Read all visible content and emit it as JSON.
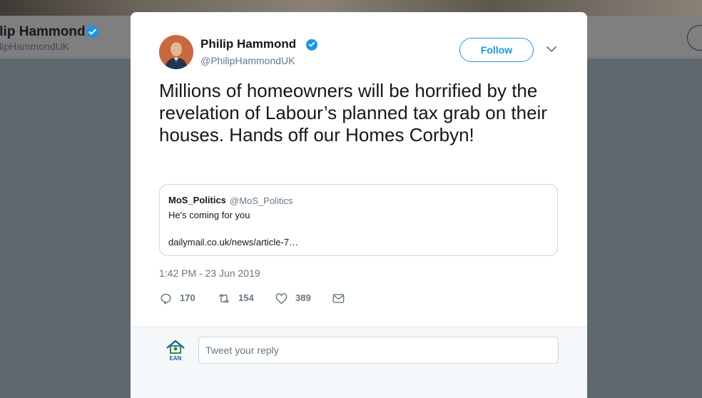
{
  "background": {
    "profile_name": "ilip Hammond",
    "profile_handle": "ilipHammondUK"
  },
  "tweet": {
    "author_name": "Philip Hammond",
    "author_handle": "@PhilipHammondUK",
    "verified": true,
    "follow_label": "Follow",
    "text": "Millions of homeowners will be horrified by the revelation of Labour’s planned tax grab on their houses. Hands off our Homes Corbyn!",
    "timestamp": "1:42 PM - 23 Jun 2019",
    "actions": {
      "replies": "170",
      "retweets": "154",
      "likes": "389"
    }
  },
  "quoted_tweet": {
    "author_name": "MoS_Politics",
    "author_handle": "@MoS_Politics",
    "text": "He's coming for you",
    "link": "dailymail.co.uk/news/article-7…"
  },
  "reply": {
    "placeholder": "Tweet your reply"
  },
  "icons": {
    "verified": "verified-badge-icon",
    "chevron": "chevron-down-icon",
    "reply": "reply-icon",
    "retweet": "retweet-icon",
    "like": "heart-icon",
    "dm": "envelope-icon"
  },
  "colors": {
    "accent": "#1b95e0",
    "text": "#14171a",
    "secondary": "#657786",
    "overlay": "#5f686d"
  }
}
